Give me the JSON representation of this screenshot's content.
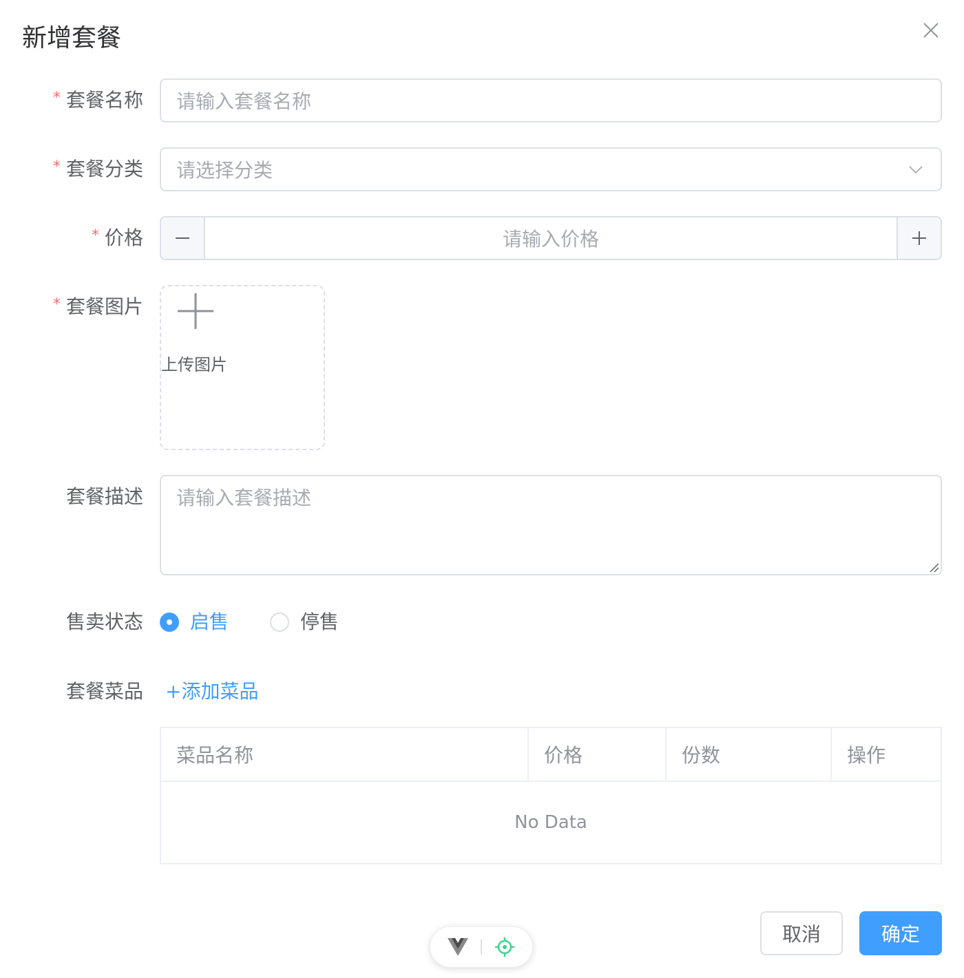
{
  "dialog": {
    "title": "新增套餐"
  },
  "fields": {
    "name": {
      "label": "套餐名称",
      "placeholder": "请输入套餐名称",
      "required": "*"
    },
    "category": {
      "label": "套餐分类",
      "placeholder": "请选择分类",
      "required": "*"
    },
    "price": {
      "label": "价格",
      "placeholder": "请输入价格",
      "required": "*"
    },
    "image": {
      "label": "套餐图片",
      "upload_text": "上传图片",
      "required": "*"
    },
    "description": {
      "label": "套餐描述",
      "placeholder": "请输入套餐描述"
    },
    "status": {
      "label": "售卖状态",
      "options": [
        "启售",
        "停售"
      ],
      "selected": "启售"
    },
    "dishes": {
      "label": "套餐菜品",
      "add_link": "+添加菜品"
    }
  },
  "table": {
    "columns": [
      "菜品名称",
      "价格",
      "份数",
      "操作"
    ],
    "empty_text": "No Data"
  },
  "footer": {
    "cancel": "取消",
    "confirm": "确定"
  },
  "colors": {
    "primary": "#409eff",
    "required": "#f56c6c",
    "border": "#dcdfe6",
    "placeholder": "#a8abb2"
  },
  "icons": {
    "close": "close-icon",
    "dropdown": "chevron-down-icon",
    "upload": "plus-icon",
    "devtools_logo": "vue-logo-icon",
    "devtools_inspect": "crosshair-icon"
  }
}
